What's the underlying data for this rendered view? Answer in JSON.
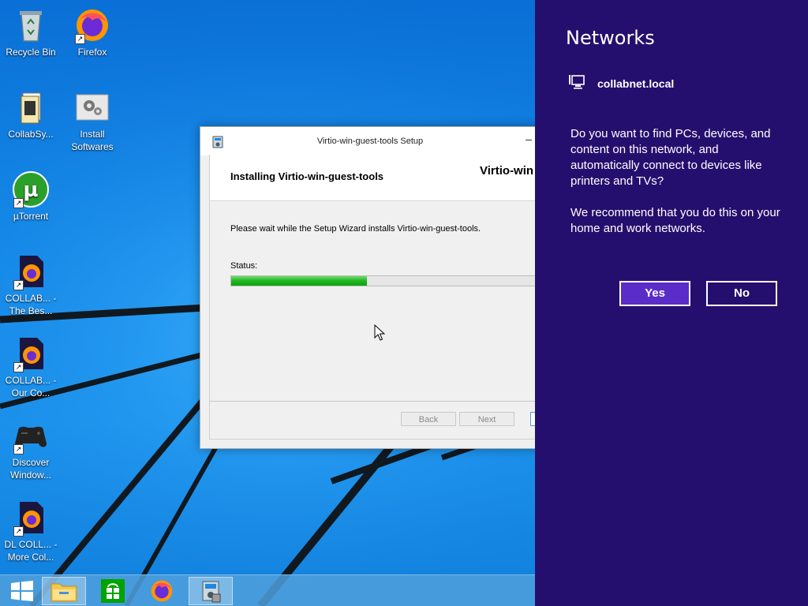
{
  "desktop": {
    "icons": [
      {
        "name": "Recycle Bin",
        "icon": "recycle-bin-icon"
      },
      {
        "name": "Firefox",
        "icon": "firefox-icon"
      },
      {
        "name": "CollabSy...",
        "icon": "folder-document-icon"
      },
      {
        "name": "Install Softwares",
        "icon": "gears-icon"
      },
      {
        "name": "µTorrent",
        "icon": "utorrent-icon"
      },
      {
        "name": "COLLAB... - The Bes...",
        "icon": "firefox-document-icon"
      },
      {
        "name": "COLLAB... - Our Co...",
        "icon": "firefox-document-icon"
      },
      {
        "name": "Discover Window...",
        "icon": "gamepad-icon"
      },
      {
        "name": "DL COLL... - More Col...",
        "icon": "firefox-document-icon"
      }
    ]
  },
  "setup_dialog": {
    "title": "Virtio-win-guest-tools Setup",
    "heading": "Installing Virtio-win-guest-tools",
    "brand": "Virtio-win",
    "description": "Please wait while the Setup Wizard installs Virtio-win-guest-tools.",
    "status_label": "Status:",
    "progress_fraction": 0.43,
    "buttons": {
      "back": "Back",
      "next": "Next"
    },
    "minimize_glyph": "–"
  },
  "network_panel": {
    "title": "Networks",
    "network_name": "collabnet.local",
    "question": "Do you want to find PCs, devices, and content on this network, and automatically connect to devices like printers and TVs?",
    "recommendation": "We recommend that you do this on your home and work networks.",
    "yes_label": "Yes",
    "no_label": "No",
    "bg_color": "#250f6e",
    "yes_color": "#5a2cc8"
  },
  "taskbar": {
    "items": [
      "start-icon",
      "file-explorer-icon",
      "store-icon",
      "firefox-icon",
      "setup-installer-icon"
    ]
  }
}
